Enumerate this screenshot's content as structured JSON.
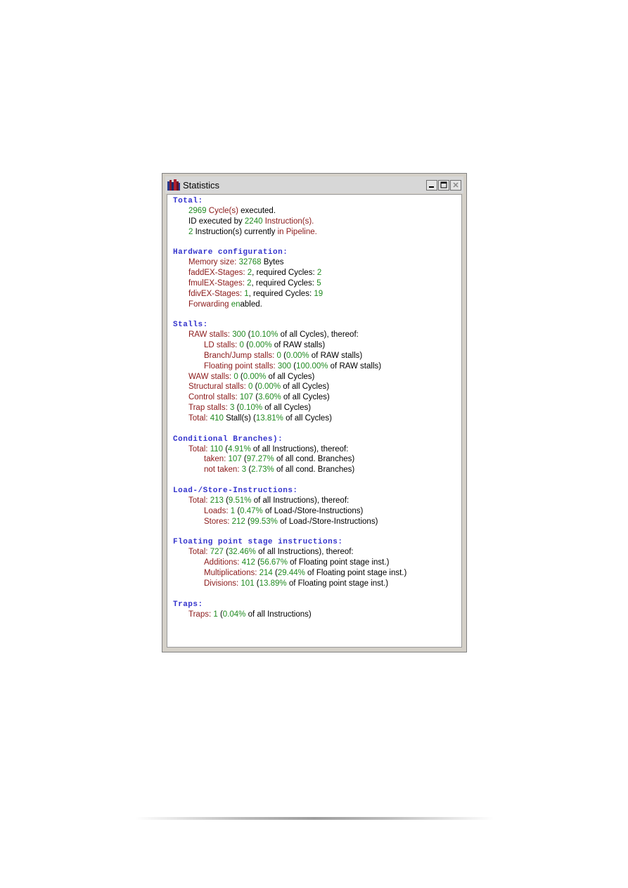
{
  "window": {
    "title": "Statistics",
    "app_icon": "books-icon"
  },
  "sections": {
    "total": {
      "heading": "Total:",
      "lines": [
        [
          [
            "2969 ",
            "g"
          ],
          [
            "Cycle(s)",
            "r"
          ],
          [
            " executed.",
            "k"
          ]
        ],
        [
          [
            "ID executed by ",
            "k"
          ],
          [
            "2240",
            "g"
          ],
          [
            " Instruction(s).",
            "r"
          ]
        ],
        [
          [
            "2",
            "g"
          ],
          [
            " Instruction(s) currently ",
            "k"
          ],
          [
            "in Pipeline.",
            "r"
          ]
        ]
      ]
    },
    "hardware": {
      "heading": "Hardware configuration:",
      "lines": [
        [
          [
            "Memory size: ",
            "r"
          ],
          [
            "32768",
            "g"
          ],
          [
            " Bytes",
            "k"
          ]
        ],
        [
          [
            "faddEX-Stages: ",
            "r"
          ],
          [
            "2",
            "g"
          ],
          [
            ", required Cycles: ",
            "k"
          ],
          [
            "2",
            "g"
          ]
        ],
        [
          [
            "fmulEX-Stages: ",
            "r"
          ],
          [
            "2",
            "g"
          ],
          [
            ", required Cycles: ",
            "k"
          ],
          [
            "5",
            "g"
          ]
        ],
        [
          [
            "fdivEX-Stages: ",
            "r"
          ],
          [
            "1",
            "g"
          ],
          [
            ", required Cycles: ",
            "k"
          ],
          [
            "19",
            "g"
          ]
        ],
        [
          [
            "Forwarding ",
            "r"
          ],
          [
            "en",
            "g"
          ],
          [
            "abled.",
            "k"
          ]
        ]
      ]
    },
    "stalls": {
      "heading": "Stalls:",
      "lines": [
        [
          1,
          [
            "RAW stalls: ",
            "r"
          ],
          [
            "300",
            "g"
          ],
          [
            " (",
            "k"
          ],
          [
            "10.10%",
            "g"
          ],
          [
            " of all Cycles), thereof:",
            "k"
          ]
        ],
        [
          2,
          [
            "LD stalls: ",
            "r"
          ],
          [
            "0",
            "g"
          ],
          [
            " (",
            "k"
          ],
          [
            "0.00%",
            "g"
          ],
          [
            " of RAW stalls)",
            "k"
          ]
        ],
        [
          2,
          [
            "Branch/Jump stalls: ",
            "r"
          ],
          [
            "0",
            "g"
          ],
          [
            " (",
            "k"
          ],
          [
            "0.00%",
            "g"
          ],
          [
            " of RAW stalls)",
            "k"
          ]
        ],
        [
          2,
          [
            "Floating point stalls: ",
            "r"
          ],
          [
            "300",
            "g"
          ],
          [
            " (",
            "k"
          ],
          [
            "100.00%",
            "g"
          ],
          [
            " of RAW stalls)",
            "k"
          ]
        ],
        [
          1,
          [
            "WAW stalls: ",
            "r"
          ],
          [
            "0",
            "g"
          ],
          [
            " (",
            "k"
          ],
          [
            "0.00%",
            "g"
          ],
          [
            " of all Cycles)",
            "k"
          ]
        ],
        [
          1,
          [
            "Structural stalls: ",
            "r"
          ],
          [
            "0",
            "g"
          ],
          [
            " (",
            "k"
          ],
          [
            "0.00%",
            "g"
          ],
          [
            " of all Cycles)",
            "k"
          ]
        ],
        [
          1,
          [
            "Control stalls: ",
            "r"
          ],
          [
            "107",
            "g"
          ],
          [
            " (",
            "k"
          ],
          [
            "3.60%",
            "g"
          ],
          [
            " of all Cycles)",
            "k"
          ]
        ],
        [
          1,
          [
            "Trap stalls: ",
            "r"
          ],
          [
            "3",
            "g"
          ],
          [
            " (",
            "k"
          ],
          [
            "0.10%",
            "g"
          ],
          [
            " of all Cycles)",
            "k"
          ]
        ],
        [
          1,
          [
            "Total: ",
            "r"
          ],
          [
            "410",
            "g"
          ],
          [
            " Stall(s) (",
            "k"
          ],
          [
            "13.81%",
            "g"
          ],
          [
            " of all Cycles)",
            "k"
          ]
        ]
      ]
    },
    "branches": {
      "heading": "Conditional Branches):",
      "lines": [
        [
          1,
          [
            "Total: ",
            "r"
          ],
          [
            "110",
            "g"
          ],
          [
            " (",
            "k"
          ],
          [
            "4.91%",
            "g"
          ],
          [
            " of all Instructions), thereof:",
            "k"
          ]
        ],
        [
          2,
          [
            "taken: ",
            "r"
          ],
          [
            "107",
            "g"
          ],
          [
            " (",
            "k"
          ],
          [
            "97.27%",
            "g"
          ],
          [
            " of all cond. Branches)",
            "k"
          ]
        ],
        [
          2,
          [
            "not taken: ",
            "r"
          ],
          [
            "3",
            "g"
          ],
          [
            " (",
            "k"
          ],
          [
            "2.73%",
            "g"
          ],
          [
            " of all cond. Branches)",
            "k"
          ]
        ]
      ]
    },
    "loadstore": {
      "heading": "Load-/Store-Instructions:",
      "lines": [
        [
          1,
          [
            "Total: ",
            "r"
          ],
          [
            "213",
            "g"
          ],
          [
            " (",
            "k"
          ],
          [
            "9.51%",
            "g"
          ],
          [
            " of all Instructions), thereof:",
            "k"
          ]
        ],
        [
          2,
          [
            "Loads: ",
            "r"
          ],
          [
            "1",
            "g"
          ],
          [
            " (",
            "k"
          ],
          [
            "0.47%",
            "g"
          ],
          [
            " of Load-/Store-Instructions)",
            "k"
          ]
        ],
        [
          2,
          [
            "Stores: ",
            "r"
          ],
          [
            "212",
            "g"
          ],
          [
            " (",
            "k"
          ],
          [
            "99.53%",
            "g"
          ],
          [
            " of Load-/Store-Instructions)",
            "k"
          ]
        ]
      ]
    },
    "floating": {
      "heading": "Floating point stage instructions:",
      "lines": [
        [
          1,
          [
            "Total: ",
            "r"
          ],
          [
            "727",
            "g"
          ],
          [
            " (",
            "k"
          ],
          [
            "32.46%",
            "g"
          ],
          [
            " of all Instructions), thereof:",
            "k"
          ]
        ],
        [
          2,
          [
            "Additions: ",
            "r"
          ],
          [
            "412",
            "g"
          ],
          [
            " (",
            "k"
          ],
          [
            "56.67%",
            "g"
          ],
          [
            " of Floating point stage inst.)",
            "k"
          ]
        ],
        [
          2,
          [
            "Multiplications: ",
            "r"
          ],
          [
            "214",
            "g"
          ],
          [
            " (",
            "k"
          ],
          [
            "29.44%",
            "g"
          ],
          [
            " of Floating point stage inst.)",
            "k"
          ]
        ],
        [
          2,
          [
            "Divisions: ",
            "r"
          ],
          [
            "101",
            "g"
          ],
          [
            " (",
            "k"
          ],
          [
            "13.89%",
            "g"
          ],
          [
            " of Floating point stage inst.)",
            "k"
          ]
        ]
      ]
    },
    "traps": {
      "heading": "Traps:",
      "lines": [
        [
          1,
          [
            "Traps: ",
            "r"
          ],
          [
            "1",
            "g"
          ],
          [
            " (",
            "k"
          ],
          [
            "0.04%",
            "g"
          ],
          [
            " of all Instructions)",
            "k"
          ]
        ]
      ]
    }
  },
  "colors": {
    "heading": "#3333cc",
    "label": "#8b1a1a",
    "value": "#208a20",
    "text": "#000000"
  }
}
